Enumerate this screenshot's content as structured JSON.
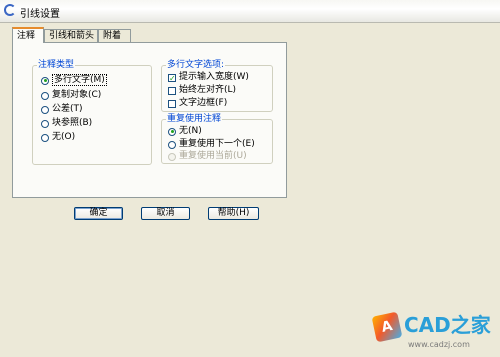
{
  "window": {
    "title": "引线设置"
  },
  "tabs": [
    {
      "label": "注释",
      "active": true
    },
    {
      "label": "引线和箭头",
      "active": false
    },
    {
      "label": "附着",
      "active": false
    }
  ],
  "annotation_type": {
    "title": "注释类型",
    "options": [
      {
        "label": "多行文字(M)",
        "selected": true
      },
      {
        "label": "复制对象(C)",
        "selected": false
      },
      {
        "label": "公差(T)",
        "selected": false
      },
      {
        "label": "块参照(B)",
        "selected": false
      },
      {
        "label": "无(O)",
        "selected": false
      }
    ]
  },
  "mtext_options": {
    "title": "多行文字选项:",
    "options": [
      {
        "label": "提示输入宽度(W)",
        "checked": true
      },
      {
        "label": "始终左对齐(L)",
        "checked": false
      },
      {
        "label": "文字边框(F)",
        "checked": false
      }
    ]
  },
  "reuse": {
    "title": "重复使用注释",
    "options": [
      {
        "label": "无(N)",
        "selected": true,
        "enabled": true
      },
      {
        "label": "重复使用下一个(E)",
        "selected": false,
        "enabled": true
      },
      {
        "label": "重复使用当前(U)",
        "selected": false,
        "enabled": false
      }
    ]
  },
  "buttons": {
    "ok": "确定",
    "cancel": "取消",
    "help": "帮助(H)"
  },
  "watermark": {
    "title": "CAD之家",
    "url": "www.cadzj.com",
    "logo_letter": "A"
  }
}
